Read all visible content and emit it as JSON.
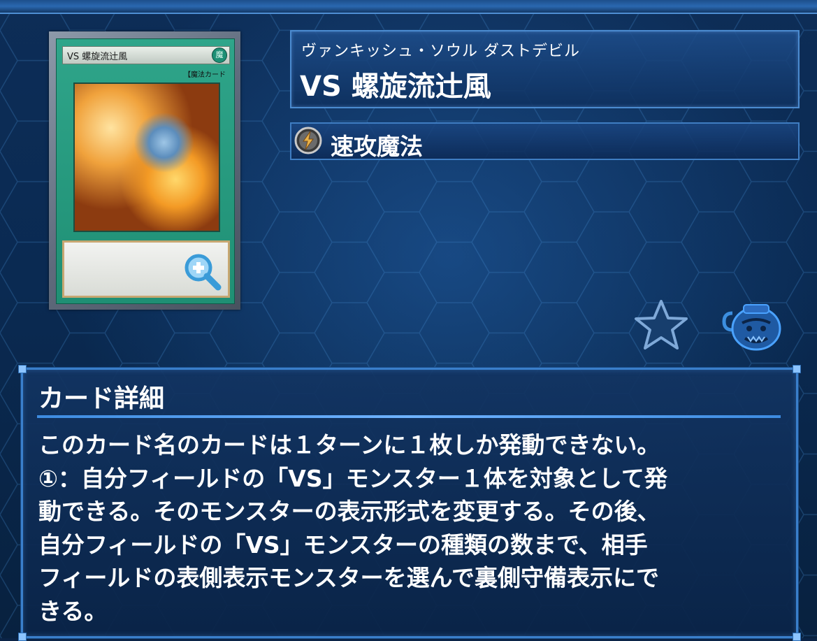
{
  "card": {
    "name_plate_text": "VS 螺旋流辻風",
    "attribute_icon": "spell-attribute-icon",
    "type_line": "【魔法カード",
    "zoom_icon": "zoom-in-icon"
  },
  "header": {
    "reading": "ヴァンキッシュ・ソウル ダストデビル",
    "name": "VS 螺旋流辻風"
  },
  "type": {
    "icon": "quick-play-spell-icon",
    "label": "速攻魔法"
  },
  "actions": {
    "favorite_icon": "star-icon",
    "pot_icon": "pot-icon"
  },
  "detail": {
    "title": "カード詳細",
    "text": "このカード名のカードは１ターンに１枚しか発動できない。\n①：自分フィールドの「VS」モンスター１体を対象として発\n動できる。そのモンスターの表示形式を変更する。その後、\n自分フィールドの「VS」モンスターの種類の数まで、相手\nフィールドの表側表示モンスターを選んで裏側守備表示にで\nきる。"
  },
  "colors": {
    "background": "#0b2447",
    "panel_border": "#4b8bd0",
    "card_frame": "#2fa58a"
  }
}
